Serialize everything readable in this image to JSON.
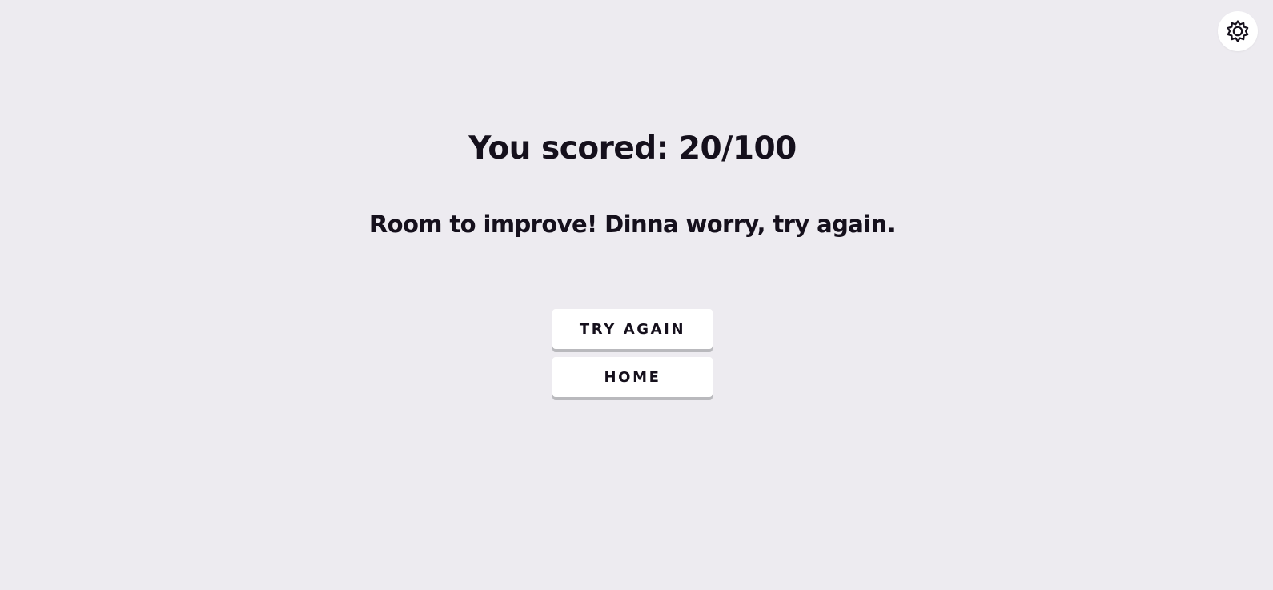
{
  "settings": {
    "icon": "gear-icon"
  },
  "result": {
    "score_text": "You scored: 20/100",
    "message": "Room to improve! Dinna worry, try again."
  },
  "actions": {
    "try_again_label": "TRY AGAIN",
    "home_label": "HOME"
  },
  "colors": {
    "background": "#edebf0",
    "text": "#15101c",
    "button_bg": "#ffffff",
    "button_shadow": "#b9b9bd"
  }
}
